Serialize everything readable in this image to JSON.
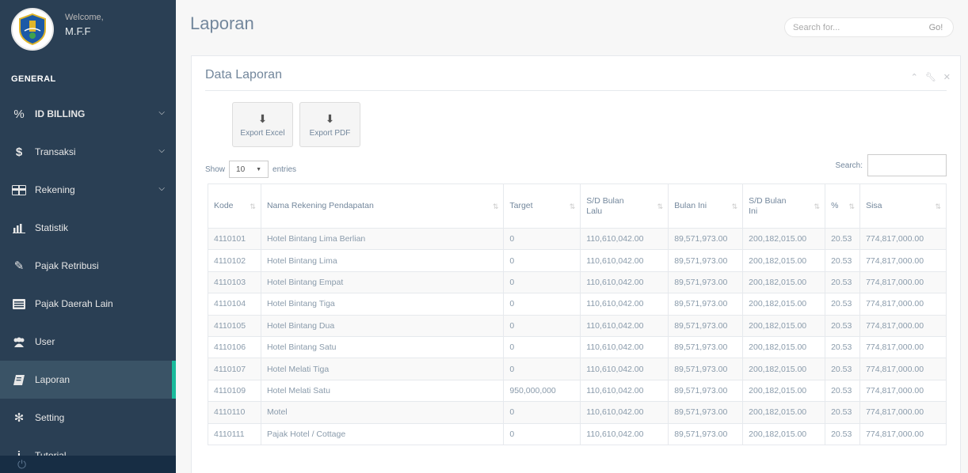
{
  "profile": {
    "welcome": "Welcome,",
    "name": "M.F.F"
  },
  "sidebar": {
    "section": "GENERAL",
    "items": [
      {
        "label": "ID BILLING",
        "icon": "percent-icon",
        "has_chevron": true
      },
      {
        "label": "Transaksi",
        "icon": "dollar-icon",
        "has_chevron": true
      },
      {
        "label": "Rekening",
        "icon": "card-icon",
        "has_chevron": true
      },
      {
        "label": "Statistik",
        "icon": "bar-chart-icon",
        "has_chevron": false
      },
      {
        "label": "Pajak Retribusi",
        "icon": "edit-icon",
        "has_chevron": false
      },
      {
        "label": "Pajak Daerah Lain",
        "icon": "list-icon",
        "has_chevron": false
      },
      {
        "label": "User",
        "icon": "users-icon",
        "has_chevron": false
      },
      {
        "label": "Laporan",
        "icon": "book-icon",
        "has_chevron": false,
        "active": true
      },
      {
        "label": "Setting",
        "icon": "cogs-icon",
        "has_chevron": false
      },
      {
        "label": "Tutorial",
        "icon": "info-icon",
        "has_chevron": false
      }
    ]
  },
  "header": {
    "title": "Laporan",
    "search_placeholder": "Search for...",
    "go_label": "Go!"
  },
  "panel": {
    "title": "Data Laporan",
    "export_excel": "Export Excel",
    "export_pdf": "Export PDF",
    "show_label": "Show",
    "entries_value": "10",
    "entries_label": "entries",
    "search_label": "Search:"
  },
  "table": {
    "headers": [
      "Kode",
      "Nama Rekening Pendapatan",
      "Target",
      "S/D Bulan Lalu",
      "Bulan Ini",
      "S/D Bulan Ini",
      "%",
      "Sisa"
    ],
    "rows": [
      [
        "4110101",
        "Hotel Bintang Lima Berlian",
        "0",
        "110,610,042.00",
        "89,571,973.00",
        "200,182,015.00",
        "20.53",
        "774,817,000.00"
      ],
      [
        "4110102",
        "Hotel Bintang Lima",
        "0",
        "110,610,042.00",
        "89,571,973.00",
        "200,182,015.00",
        "20.53",
        "774,817,000.00"
      ],
      [
        "4110103",
        "Hotel Bintang Empat",
        "0",
        "110,610,042.00",
        "89,571,973.00",
        "200,182,015.00",
        "20.53",
        "774,817,000.00"
      ],
      [
        "4110104",
        "Hotel Bintang Tiga",
        "0",
        "110,610,042.00",
        "89,571,973.00",
        "200,182,015.00",
        "20.53",
        "774,817,000.00"
      ],
      [
        "4110105",
        "Hotel Bintang Dua",
        "0",
        "110,610,042.00",
        "89,571,973.00",
        "200,182,015.00",
        "20.53",
        "774,817,000.00"
      ],
      [
        "4110106",
        "Hotel Bintang Satu",
        "0",
        "110,610,042.00",
        "89,571,973.00",
        "200,182,015.00",
        "20.53",
        "774,817,000.00"
      ],
      [
        "4110107",
        "Hotel Melati Tiga",
        "0",
        "110,610,042.00",
        "89,571,973.00",
        "200,182,015.00",
        "20.53",
        "774,817,000.00"
      ],
      [
        "4110109",
        "Hotel Melati Satu",
        "950,000,000",
        "110,610,042.00",
        "89,571,973.00",
        "200,182,015.00",
        "20.53",
        "774,817,000.00"
      ],
      [
        "4110110",
        "Motel",
        "0",
        "110,610,042.00",
        "89,571,973.00",
        "200,182,015.00",
        "20.53",
        "774,817,000.00"
      ],
      [
        "4110111",
        "Pajak Hotel / Cottage",
        "0",
        "110,610,042.00",
        "89,571,973.00",
        "200,182,015.00",
        "20.53",
        "774,817,000.00"
      ]
    ]
  }
}
